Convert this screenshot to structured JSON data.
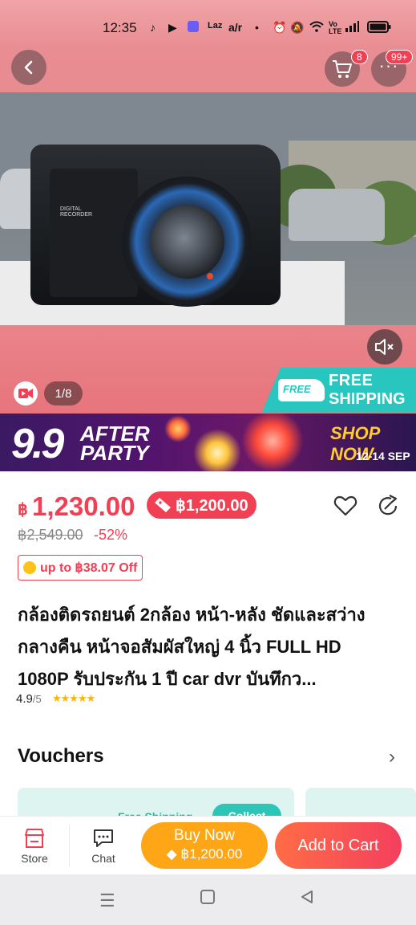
{
  "status_bar": {
    "time": "12:35",
    "apps": [
      "tiktok-icon",
      "youtube-icon",
      "app-icon",
      "lazada-icon",
      "airasia-icon"
    ],
    "system": [
      "alarm-icon",
      "mute-bell-icon",
      "wifi-icon",
      "volte-icon",
      "signal-icon",
      "battery-icon"
    ]
  },
  "header": {
    "cart_badge": "8",
    "more_badge": "99+"
  },
  "gallery": {
    "counter": "1/8"
  },
  "free_shipping": {
    "line1": "FREE",
    "line2": "SHIPPING",
    "truck_text": "FREE"
  },
  "campaign_banner": {
    "big": "9.9",
    "line1": "AFTER",
    "line2": "PARTY",
    "cta": "SHOP NOW",
    "dates": "12-14 SEP"
  },
  "price": {
    "currency": "฿",
    "current": "1,230.00",
    "promo_price": "฿1,200.00",
    "original": "฿2,549.00",
    "discount": "-52%",
    "coin_offer": "up to ฿38.07 Off"
  },
  "product": {
    "title": "กล้องติดรถยนต์ 2กล้อง หน้า-หลัง ชัดและสว่างกลางคืน หน้าจอสัมผัสใหญ่ 4 นิ้ว FULL HD 1080P รับประกัน 1 ปี car dvr บันทึกว...",
    "rating": "4.9",
    "rating_max": "/5",
    "stars": "★★★★★"
  },
  "vouchers": {
    "title": "Vouchers",
    "card_text": "Free Shipping",
    "collect": "Collect"
  },
  "bottom_bar": {
    "store": "Store",
    "chat": "Chat",
    "buy_now": "Buy Now",
    "buy_now_price": "฿1,200.00",
    "add_to_cart": "Add to Cart"
  },
  "colors": {
    "accent": "#f13f54",
    "orange": "#ffa616",
    "teal": "#29c6c0"
  }
}
